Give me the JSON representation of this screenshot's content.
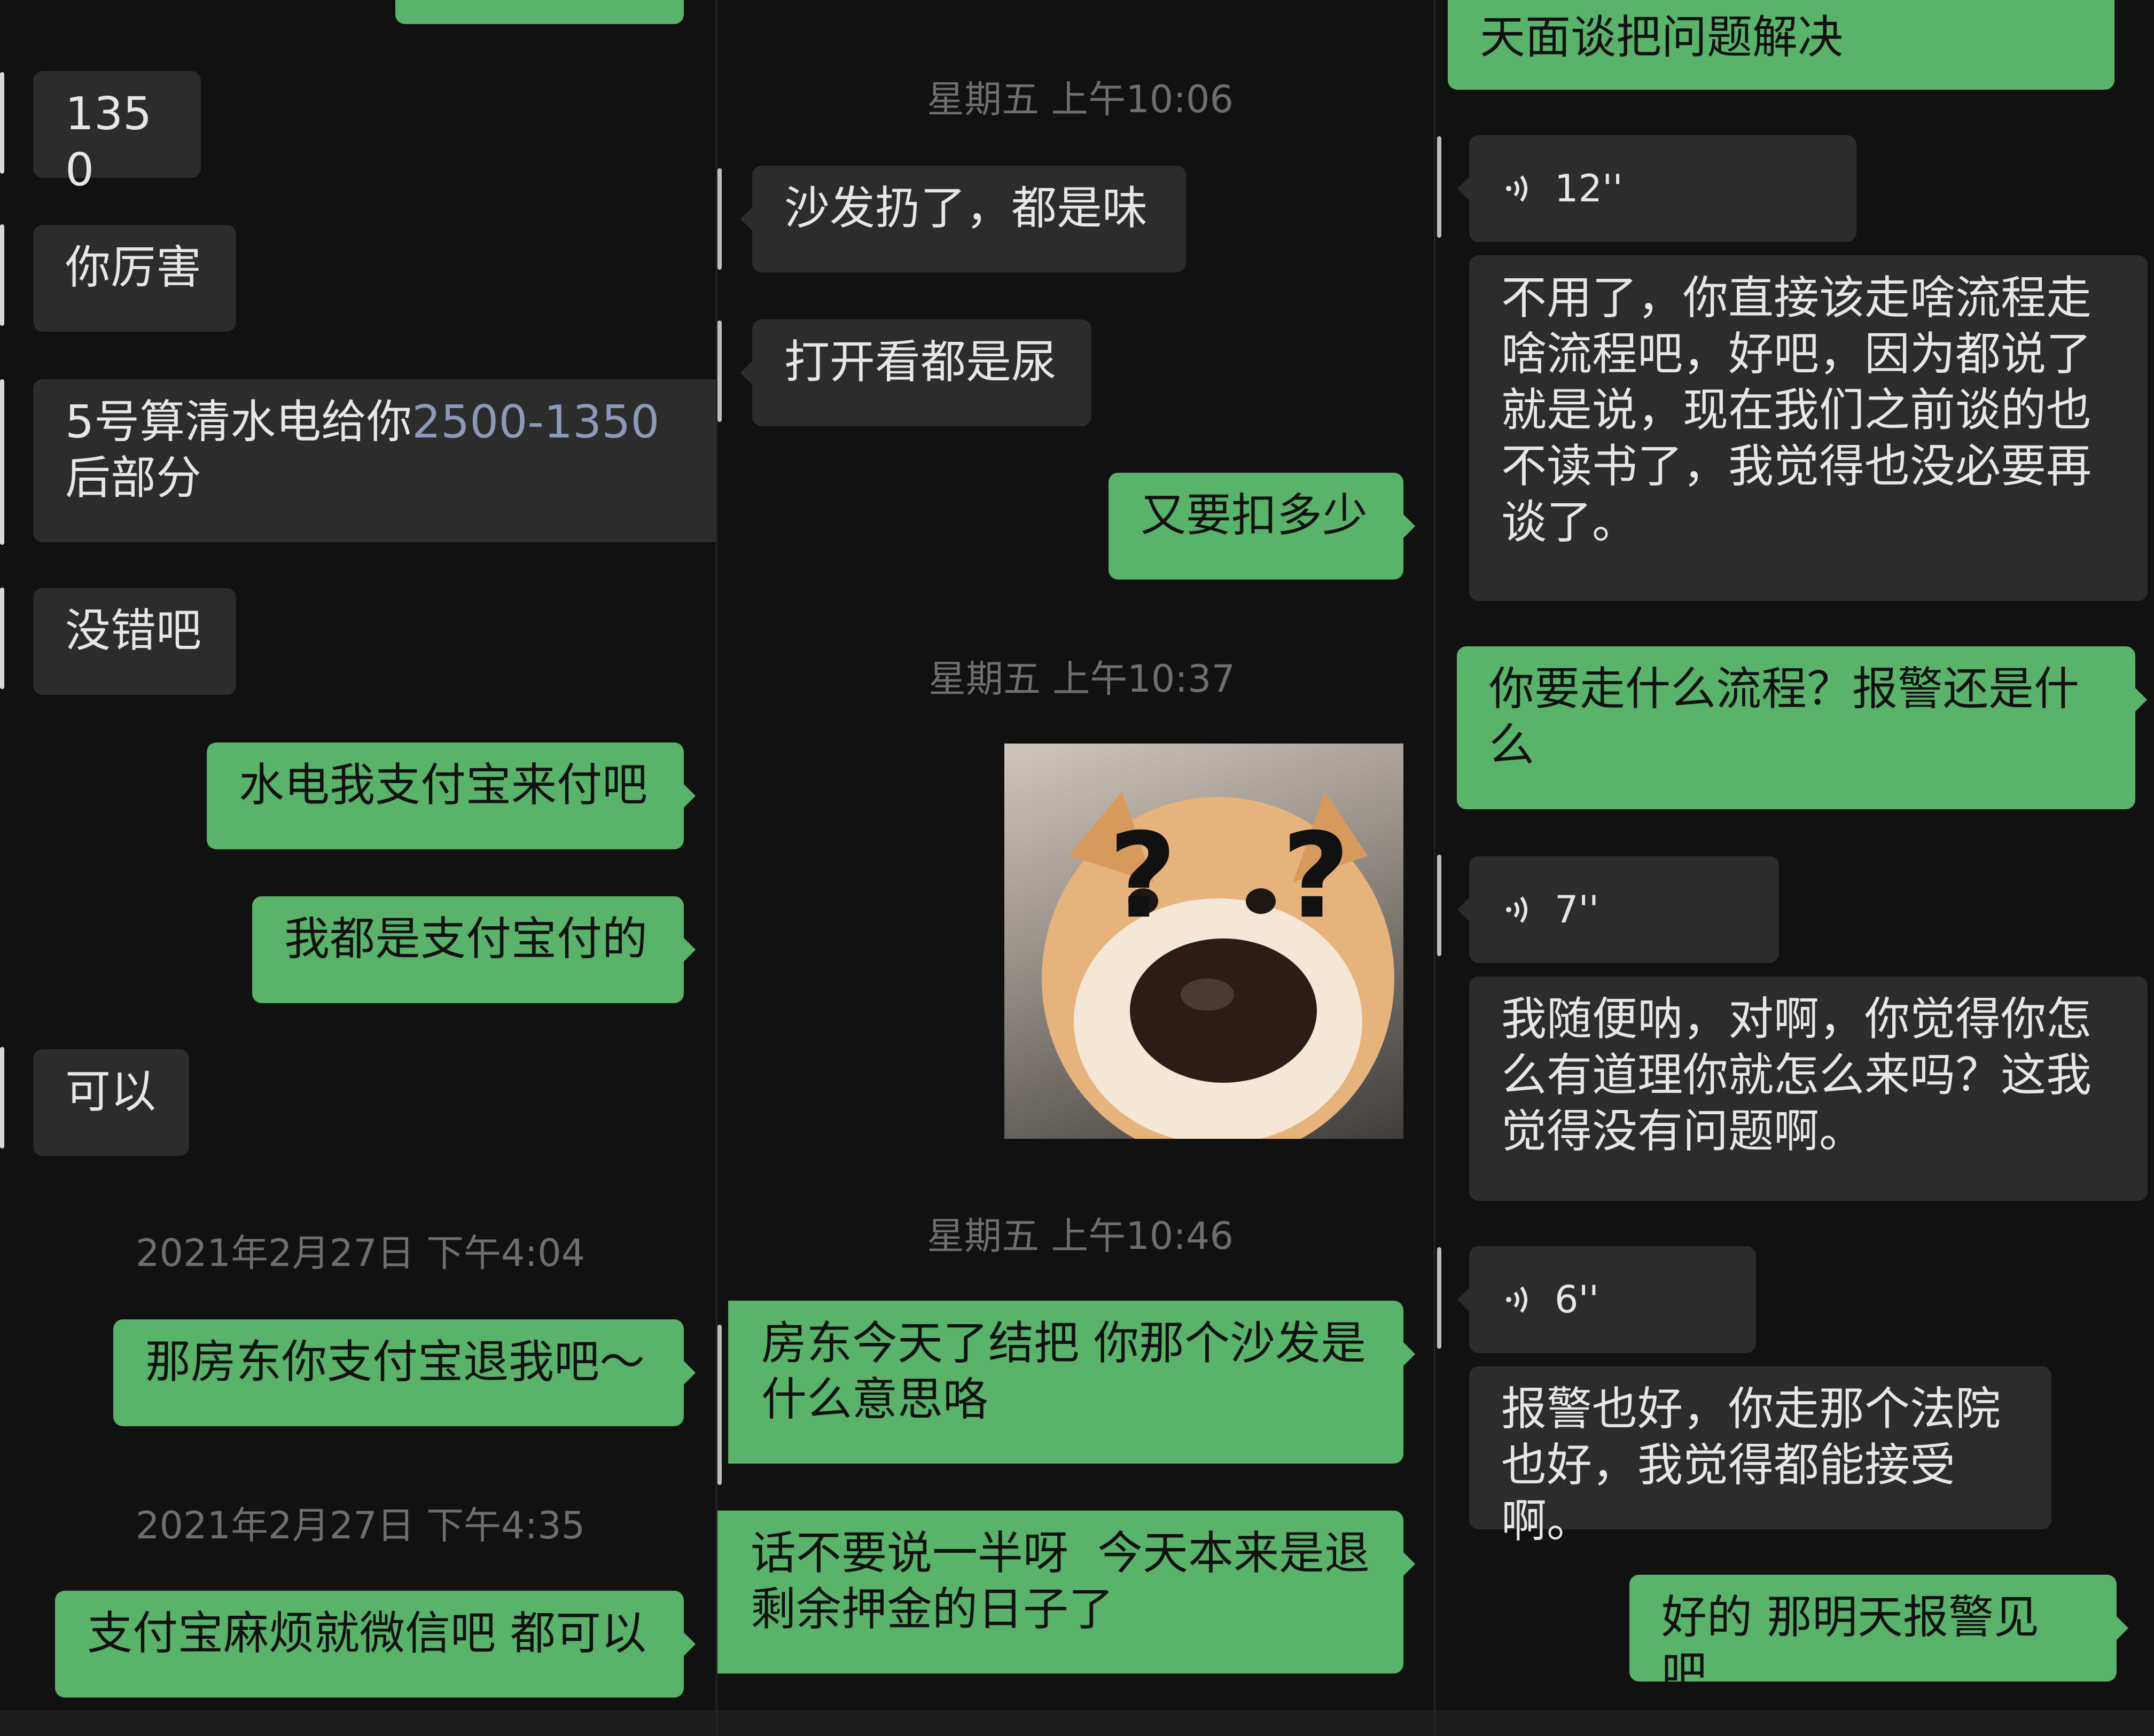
{
  "panel1": {
    "messages": [
      {
        "text": "1350"
      },
      {
        "text": "你厉害"
      },
      {
        "text_a": "5号算清水电给你",
        "text_hl": "2500-1350",
        "text_b": "后部分"
      },
      {
        "text": "没错吧"
      },
      {
        "text": "水电我支付宝来付吧"
      },
      {
        "text": "我都是支付宝付的"
      },
      {
        "text": "可以"
      },
      {
        "text": "那房东你支付宝退我吧～"
      },
      {
        "text": "支付宝麻烦就微信吧 都可以"
      }
    ],
    "timestamps": [
      "2021年2月27日 下午4:04",
      "2021年2月27日 下午4:35"
    ]
  },
  "panel2": {
    "timestamps": [
      "星期五 上午10:06",
      "星期五 上午10:37",
      "星期五 上午10:46"
    ],
    "messages": [
      {
        "text": "沙发扔了，都是味"
      },
      {
        "text": "打开看都是尿"
      },
      {
        "text": "又要扣多少"
      },
      {
        "text": "房东今天了结把 你那个沙发是什么意思咯"
      },
      {
        "text": "话不要说一半呀  今天本来是退剩余押金的日子了"
      }
    ],
    "sticker": {
      "question_marks": "? ?",
      "icon": "shiba-inu-confused-sticker"
    }
  },
  "panel3": {
    "messages": [
      {
        "text": "天面谈把问题解决"
      },
      {
        "text": "不用了，你直接该走啥流程走啥流程吧，好吧，因为都说了就是说，现在我们之前谈的也不读书了，我觉得也没必要再谈了。"
      },
      {
        "text": "你要走什么流程？报警还是什么"
      },
      {
        "text": "我随便呐，对啊，你觉得你怎么有道理你就怎么来吗？这我觉得没有问题啊。"
      },
      {
        "text": "报警也好，你走那个法院也好，我觉得都能接受啊。"
      },
      {
        "text": "好的 那明天报警见吧"
      }
    ],
    "voice": [
      {
        "duration": "12''"
      },
      {
        "duration": "7''"
      },
      {
        "duration": "6''"
      }
    ]
  },
  "colors": {
    "background": "#111111",
    "incoming_bubble": "#2c2c2c",
    "outgoing_bubble": "#5ab36a",
    "timestamp_text": "#6e6e6e",
    "highlight_number": "#8c99b8"
  }
}
